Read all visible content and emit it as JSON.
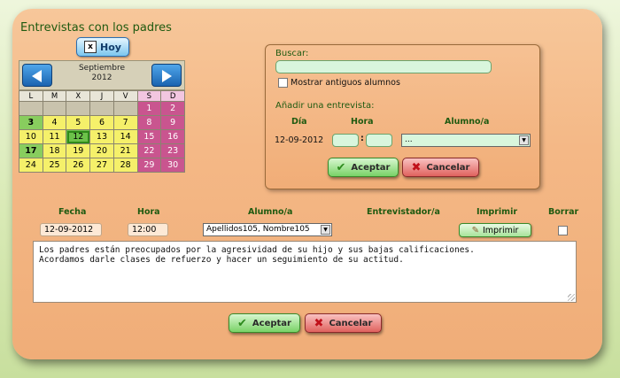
{
  "title": "Entrevistas con los padres",
  "hoy_label": "Hoy",
  "hoy_icon": "x",
  "calendar": {
    "month_label": "Septiembre",
    "year_label": "2012",
    "day_headers": [
      "L",
      "M",
      "X",
      "J",
      "V",
      "S",
      "D"
    ],
    "rows": [
      [
        "",
        "",
        "",
        "",
        "",
        "1",
        "2"
      ],
      [
        "3",
        "4",
        "5",
        "6",
        "7",
        "8",
        "9"
      ],
      [
        "10",
        "11",
        "12",
        "13",
        "14",
        "15",
        "16"
      ],
      [
        "17",
        "18",
        "19",
        "20",
        "21",
        "22",
        "23"
      ],
      [
        "24",
        "25",
        "26",
        "27",
        "28",
        "29",
        "30"
      ]
    ],
    "today": "12"
  },
  "search": {
    "label": "Buscar:",
    "value": "",
    "show_old_label": "Mostrar antiguos alumnos"
  },
  "add": {
    "label": "Añadir una entrevista:",
    "col_dia": "Día",
    "col_hora": "Hora",
    "col_alumno": "Alumno/a",
    "date_value": "12-09-2012",
    "hour_sep": ":",
    "alumno_value": "...",
    "accept_label": "Aceptar",
    "cancel_label": "Cancelar"
  },
  "list": {
    "col_fecha": "Fecha",
    "col_hora": "Hora",
    "col_alumno": "Alumno/a",
    "col_entrevistador": "Entrevistador/a",
    "col_imprimir": "Imprimir",
    "col_borrar": "Borrar",
    "fecha": "12-09-2012",
    "hora": "12:00",
    "alumno": "Apellidos105, Nombre105",
    "imprimir_label": "Imprimir",
    "notes": "Los padres están preocupados por la agresividad de su hijo y sus bajas calificaciones.\nAcordamos darle clases de refuerzo y hacer un seguimiento de su actitud."
  },
  "footer": {
    "accept_label": "Aceptar",
    "cancel_label": "Cancelar"
  },
  "colors": {
    "panel": "#f4b886",
    "accent_green": "#1f5a10",
    "weekday": "#f5f06a",
    "weekend": "#c9558f"
  }
}
